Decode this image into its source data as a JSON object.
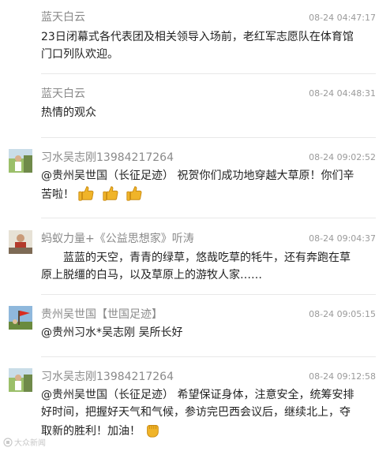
{
  "comments": [
    {
      "name": "蓝天白云",
      "time": "08-24 04:47:17",
      "lines": [
        "23日闭幕式各代表团及相关领导入场前，老红军志愿队在体育馆",
        "门口列队欢迎。"
      ],
      "avatar": "none"
    },
    {
      "name": "蓝天白云",
      "time": "08-24 04:48:31",
      "lines": [
        "热情的观众"
      ],
      "avatar": "none"
    },
    {
      "name": "习水吴志刚13984217264",
      "time": "08-24 09:02:52",
      "lines": [
        "@贵州吴世国（长征足迹） 祝贺你们成功地穿越大草原！你们辛",
        "苦啦！"
      ],
      "avatar": "person-photo",
      "emoji": [
        "thumbs-up-icon",
        "thumbs-up-icon",
        "thumbs-up-icon"
      ]
    },
    {
      "name": "蚂蚁力量+《公益思想家》听涛",
      "time": "08-24 09:04:37",
      "lines": [
        "　　蓝蓝的天空，青青的绿草，悠哉吃草的牦牛，还有奔跑在草",
        "原上脱缰的白马，以及草原上的游牧人家……"
      ],
      "avatar": "person-photo"
    },
    {
      "name": "贵州吴世国【世国足迹】",
      "time": "08-24 09:05:15",
      "lines": [
        "@贵州习水*吴志刚 吴所长好"
      ],
      "avatar": "flag-photo"
    },
    {
      "name": "习水吴志刚13984217264",
      "time": "08-24 09:12:58",
      "lines": [
        "@贵州吴世国（长征足迹） 希望保证身体，注意安全，统筹安排",
        "好时间，把握好天气和气候，参访完巴西会议后，继续北上，夺",
        "取新的胜利！加油！"
      ],
      "avatar": "person-photo",
      "emoji": [
        "fist-icon"
      ]
    }
  ],
  "watermark": "大众新闻",
  "colors": {
    "name": "#8a8a8a",
    "time": "#9a9a9a",
    "text": "#222222",
    "divider": "#e8e8e8",
    "emoji": "#f0b429"
  }
}
